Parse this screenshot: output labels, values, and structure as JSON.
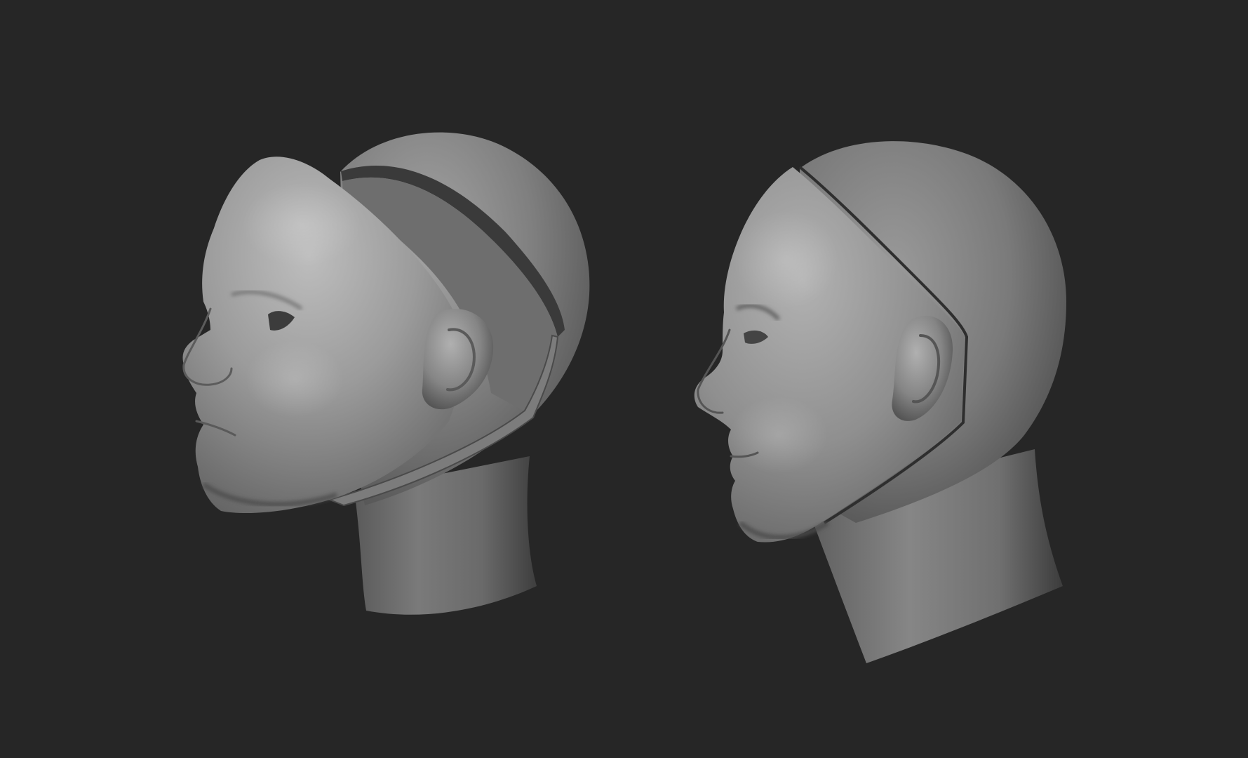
{
  "scene": {
    "background_color": "#262626",
    "clay_color": "#8a8a8a",
    "models": [
      {
        "id": "left",
        "description_key": "mask-offset",
        "facing": "left"
      },
      {
        "id": "right",
        "description_key": "mask-fitted",
        "facing": "left"
      }
    ]
  }
}
